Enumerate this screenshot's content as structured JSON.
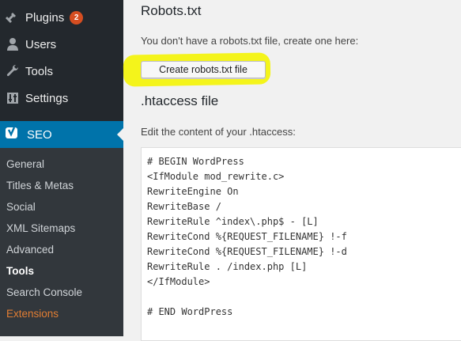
{
  "sidebar": {
    "items": [
      {
        "label": "Plugins",
        "badge": "2",
        "icon": "plugin-icon"
      },
      {
        "label": "Users",
        "icon": "user-icon"
      },
      {
        "label": "Tools",
        "icon": "wrench-icon"
      },
      {
        "label": "Settings",
        "icon": "settings-icon"
      }
    ],
    "seo": {
      "label": "SEO",
      "icon": "yoast-icon"
    },
    "submenu": [
      "General",
      "Titles & Metas",
      "Social",
      "XML Sitemaps",
      "Advanced",
      "Tools",
      "Search Console",
      "Extensions"
    ],
    "active_submenu": "Tools"
  },
  "main": {
    "robots_title": "Robots.txt",
    "robots_desc": "You don't have a robots.txt file, create one here:",
    "create_button": "Create robots.txt file",
    "htaccess_title": ".htaccess file",
    "htaccess_desc": "Edit the content of your .htaccess:",
    "htaccess_lines": [
      "# BEGIN WordPress",
      "<IfModule mod_rewrite.c>",
      "RewriteEngine On",
      "RewriteBase /",
      "RewriteRule ^index\\.php$ - [L]",
      "RewriteCond %{REQUEST_FILENAME} !-f",
      "RewriteCond %{REQUEST_FILENAME} !-d",
      "RewriteRule . /index.php [L]",
      "</IfModule>",
      "",
      "# END WordPress"
    ]
  },
  "colors": {
    "sidebar": "#23282d",
    "submenu": "#32373c",
    "accent": "#0073aa",
    "highlight": "#f4f41b",
    "extensions": "#e37e33"
  }
}
